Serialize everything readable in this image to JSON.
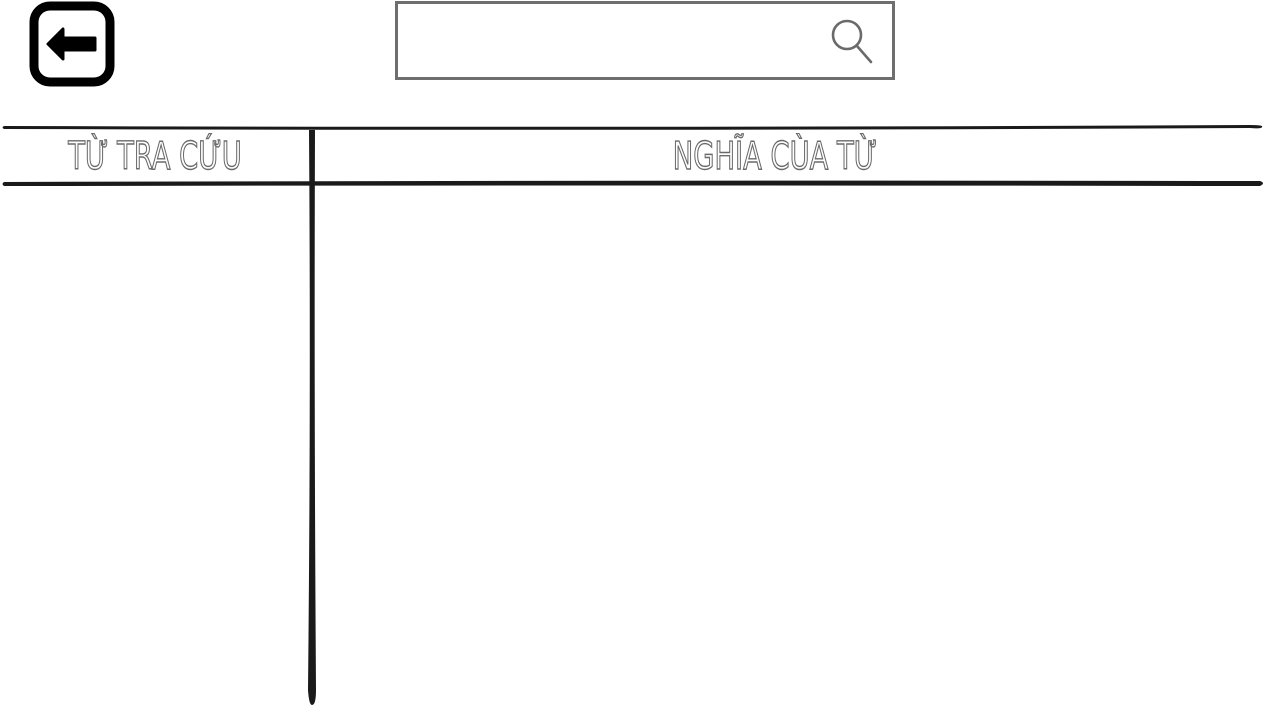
{
  "toolbar": {
    "back_icon": "arrow-left-square-icon",
    "search": {
      "value": "",
      "placeholder": "",
      "icon": "search-icon",
      "border_color": "#6e6e6e"
    }
  },
  "table": {
    "columns": [
      {
        "label": "TỪ TRA CỨU"
      },
      {
        "label": "NGHĨA CÙA TỪ"
      }
    ],
    "rows": [],
    "line_color": "#1a1a1a"
  }
}
